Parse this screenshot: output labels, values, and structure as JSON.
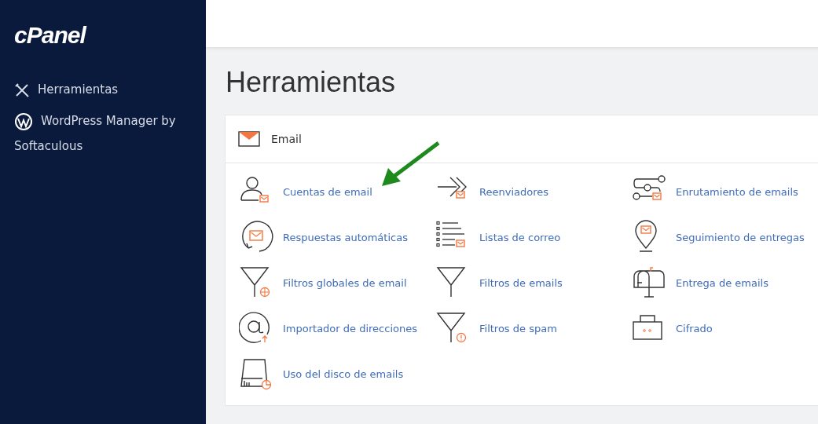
{
  "sidebar": {
    "logo": "cPanel",
    "items": [
      {
        "label": "Herramientas",
        "kind": "tools"
      },
      {
        "label": "WordPress Manager by Softaculous",
        "kind": "wordpress"
      }
    ]
  },
  "page": {
    "title": "Herramientas"
  },
  "panel": {
    "title": "Email",
    "items": [
      {
        "label": "Cuentas de email",
        "kind": "accounts"
      },
      {
        "label": "Reenviadores",
        "kind": "forwarders"
      },
      {
        "label": "Enrutamiento de emails",
        "kind": "routing"
      },
      {
        "label": "Respuestas automáticas",
        "kind": "autoresponders"
      },
      {
        "label": "Listas de correo",
        "kind": "lists"
      },
      {
        "label": "Seguimiento de entregas",
        "kind": "tracking"
      },
      {
        "label": "Filtros globales de email",
        "kind": "global_filters"
      },
      {
        "label": "Filtros de emails",
        "kind": "filters"
      },
      {
        "label": "Entrega de emails",
        "kind": "deliverability"
      },
      {
        "label": "Importador de direcciones",
        "kind": "importer"
      },
      {
        "label": "Filtros de spam",
        "kind": "spam"
      },
      {
        "label": "Cifrado",
        "kind": "encryption"
      },
      {
        "label": "Uso del disco de emails",
        "kind": "disk"
      }
    ]
  }
}
